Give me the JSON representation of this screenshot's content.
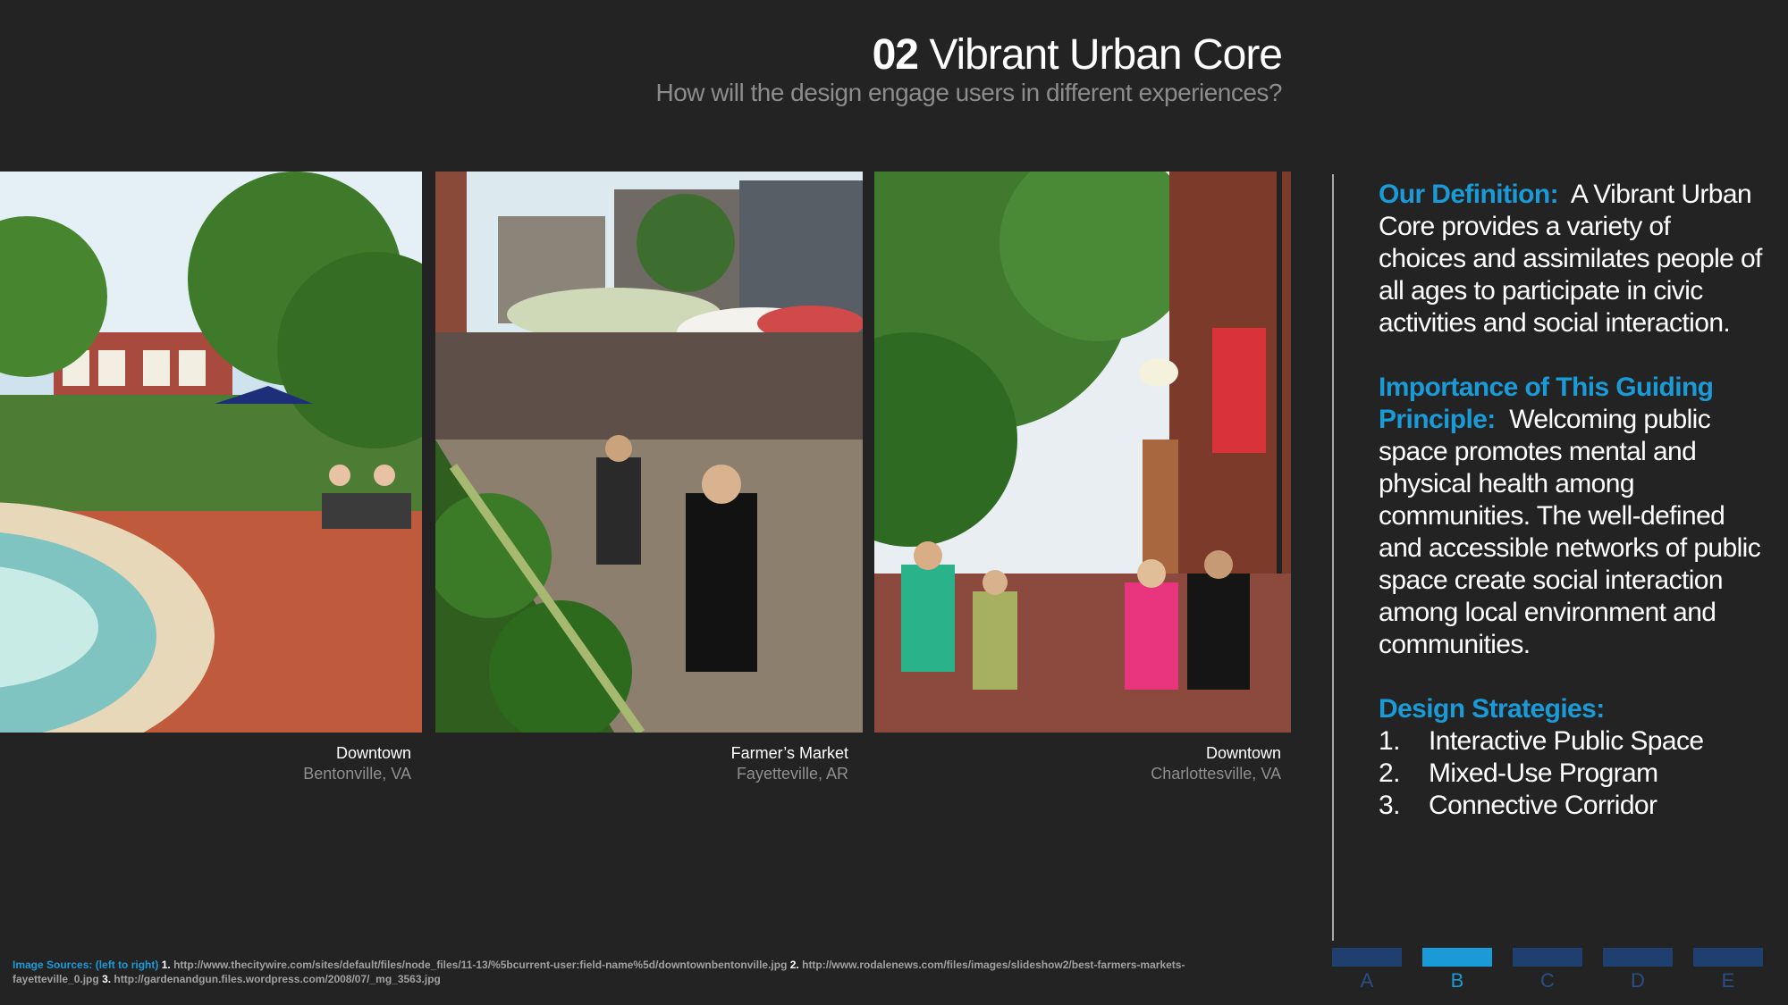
{
  "header": {
    "number": "02",
    "title": "Vibrant Urban Core",
    "subtitle": "How will the design engage users in different experiences?"
  },
  "photos": [
    {
      "caption": "Downtown",
      "location": "Bentonville, VA"
    },
    {
      "caption": "Farmer’s Market",
      "location": "Fayetteville, AR"
    },
    {
      "caption": "Downtown",
      "location": "Charlottesville, VA"
    }
  ],
  "definition": {
    "heading": "Our Definition:",
    "text": "A Vibrant Urban Core provides a variety of choices and assimilates people of all ages to participate in civic activities and social interaction."
  },
  "importance": {
    "heading": "Importance of This Guiding Principle:",
    "text": "Welcoming public space promotes mental and physical health among communities.  The well-defined and accessible networks of public space create social interaction among local environment and communities."
  },
  "strategies": {
    "heading": "Design Strategies:",
    "items": [
      {
        "num": "1.",
        "label": "Interactive Public Space"
      },
      {
        "num": "2.",
        "label": "Mixed-Use Program"
      },
      {
        "num": "3.",
        "label": "Connective Corridor"
      }
    ]
  },
  "sources": {
    "label": "Image Sources: (left to right)",
    "n1": "1.",
    "s1": "http://www.thecitywire.com/sites/default/files/node_files/11-13/%5bcurrent-user:field-name%5d/downtownbentonville.jpg",
    "n2": "2.",
    "s2": "http://www.rodalenews.com/files/images/slideshow2/best-farmers-markets-fayetteville_0.jpg",
    "n3": "3.",
    "s3": "http://gardenandgun.files.wordpress.com/2008/07/_mg_3563.jpg"
  },
  "nav": {
    "items": [
      "A",
      "B",
      "C",
      "D",
      "E"
    ],
    "active": "B"
  },
  "colors": {
    "background": "#232323",
    "accent": "#1a9bd7",
    "nav_inactive": "#1f3f6e"
  }
}
